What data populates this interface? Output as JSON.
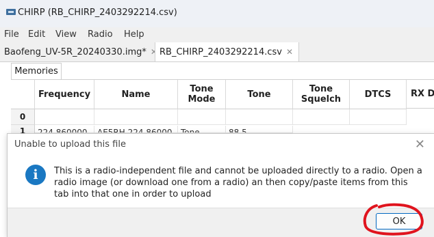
{
  "window": {
    "title": "CHIRP (RB_CHIRP_2403292214.csv)",
    "icon": "chirp-radio-icon"
  },
  "menu": {
    "items": [
      "File",
      "Edit",
      "View",
      "Radio",
      "Help"
    ]
  },
  "tabs": [
    {
      "label": "Baofeng_UV-5R_20240330.img*",
      "close": "✕",
      "active": false
    },
    {
      "label": "RB_CHIRP_2403292214.csv",
      "close": "✕",
      "active": true
    }
  ],
  "subtab": {
    "label": "Memories"
  },
  "grid": {
    "headers": [
      {
        "line1": "Frequency",
        "line2": ""
      },
      {
        "line1": "Name",
        "line2": ""
      },
      {
        "line1": "Tone",
        "line2": "Mode"
      },
      {
        "line1": "Tone",
        "line2": ""
      },
      {
        "line1": "Tone",
        "line2": "Squelch"
      },
      {
        "line1": "DTCS",
        "line2": ""
      },
      {
        "line1": "RX D",
        "line2": ""
      }
    ],
    "row_numbers": [
      "0",
      "1"
    ],
    "row1": [
      "224.860000",
      "AE5RH 224.86000",
      "Tone",
      "88.5"
    ]
  },
  "dialog": {
    "title": "Unable to upload this file",
    "close": "✕",
    "icon": "info-icon",
    "message": "This is a radio-independent file and cannot be uploaded directly to a radio. Open a radio image (or download one from a radio) an then copy/paste items from this tab into that one in order to upload",
    "ok_label": "OK"
  },
  "colors": {
    "accent": "#0067c0",
    "info": "#1a78c2",
    "annotation": "#e0141e"
  }
}
